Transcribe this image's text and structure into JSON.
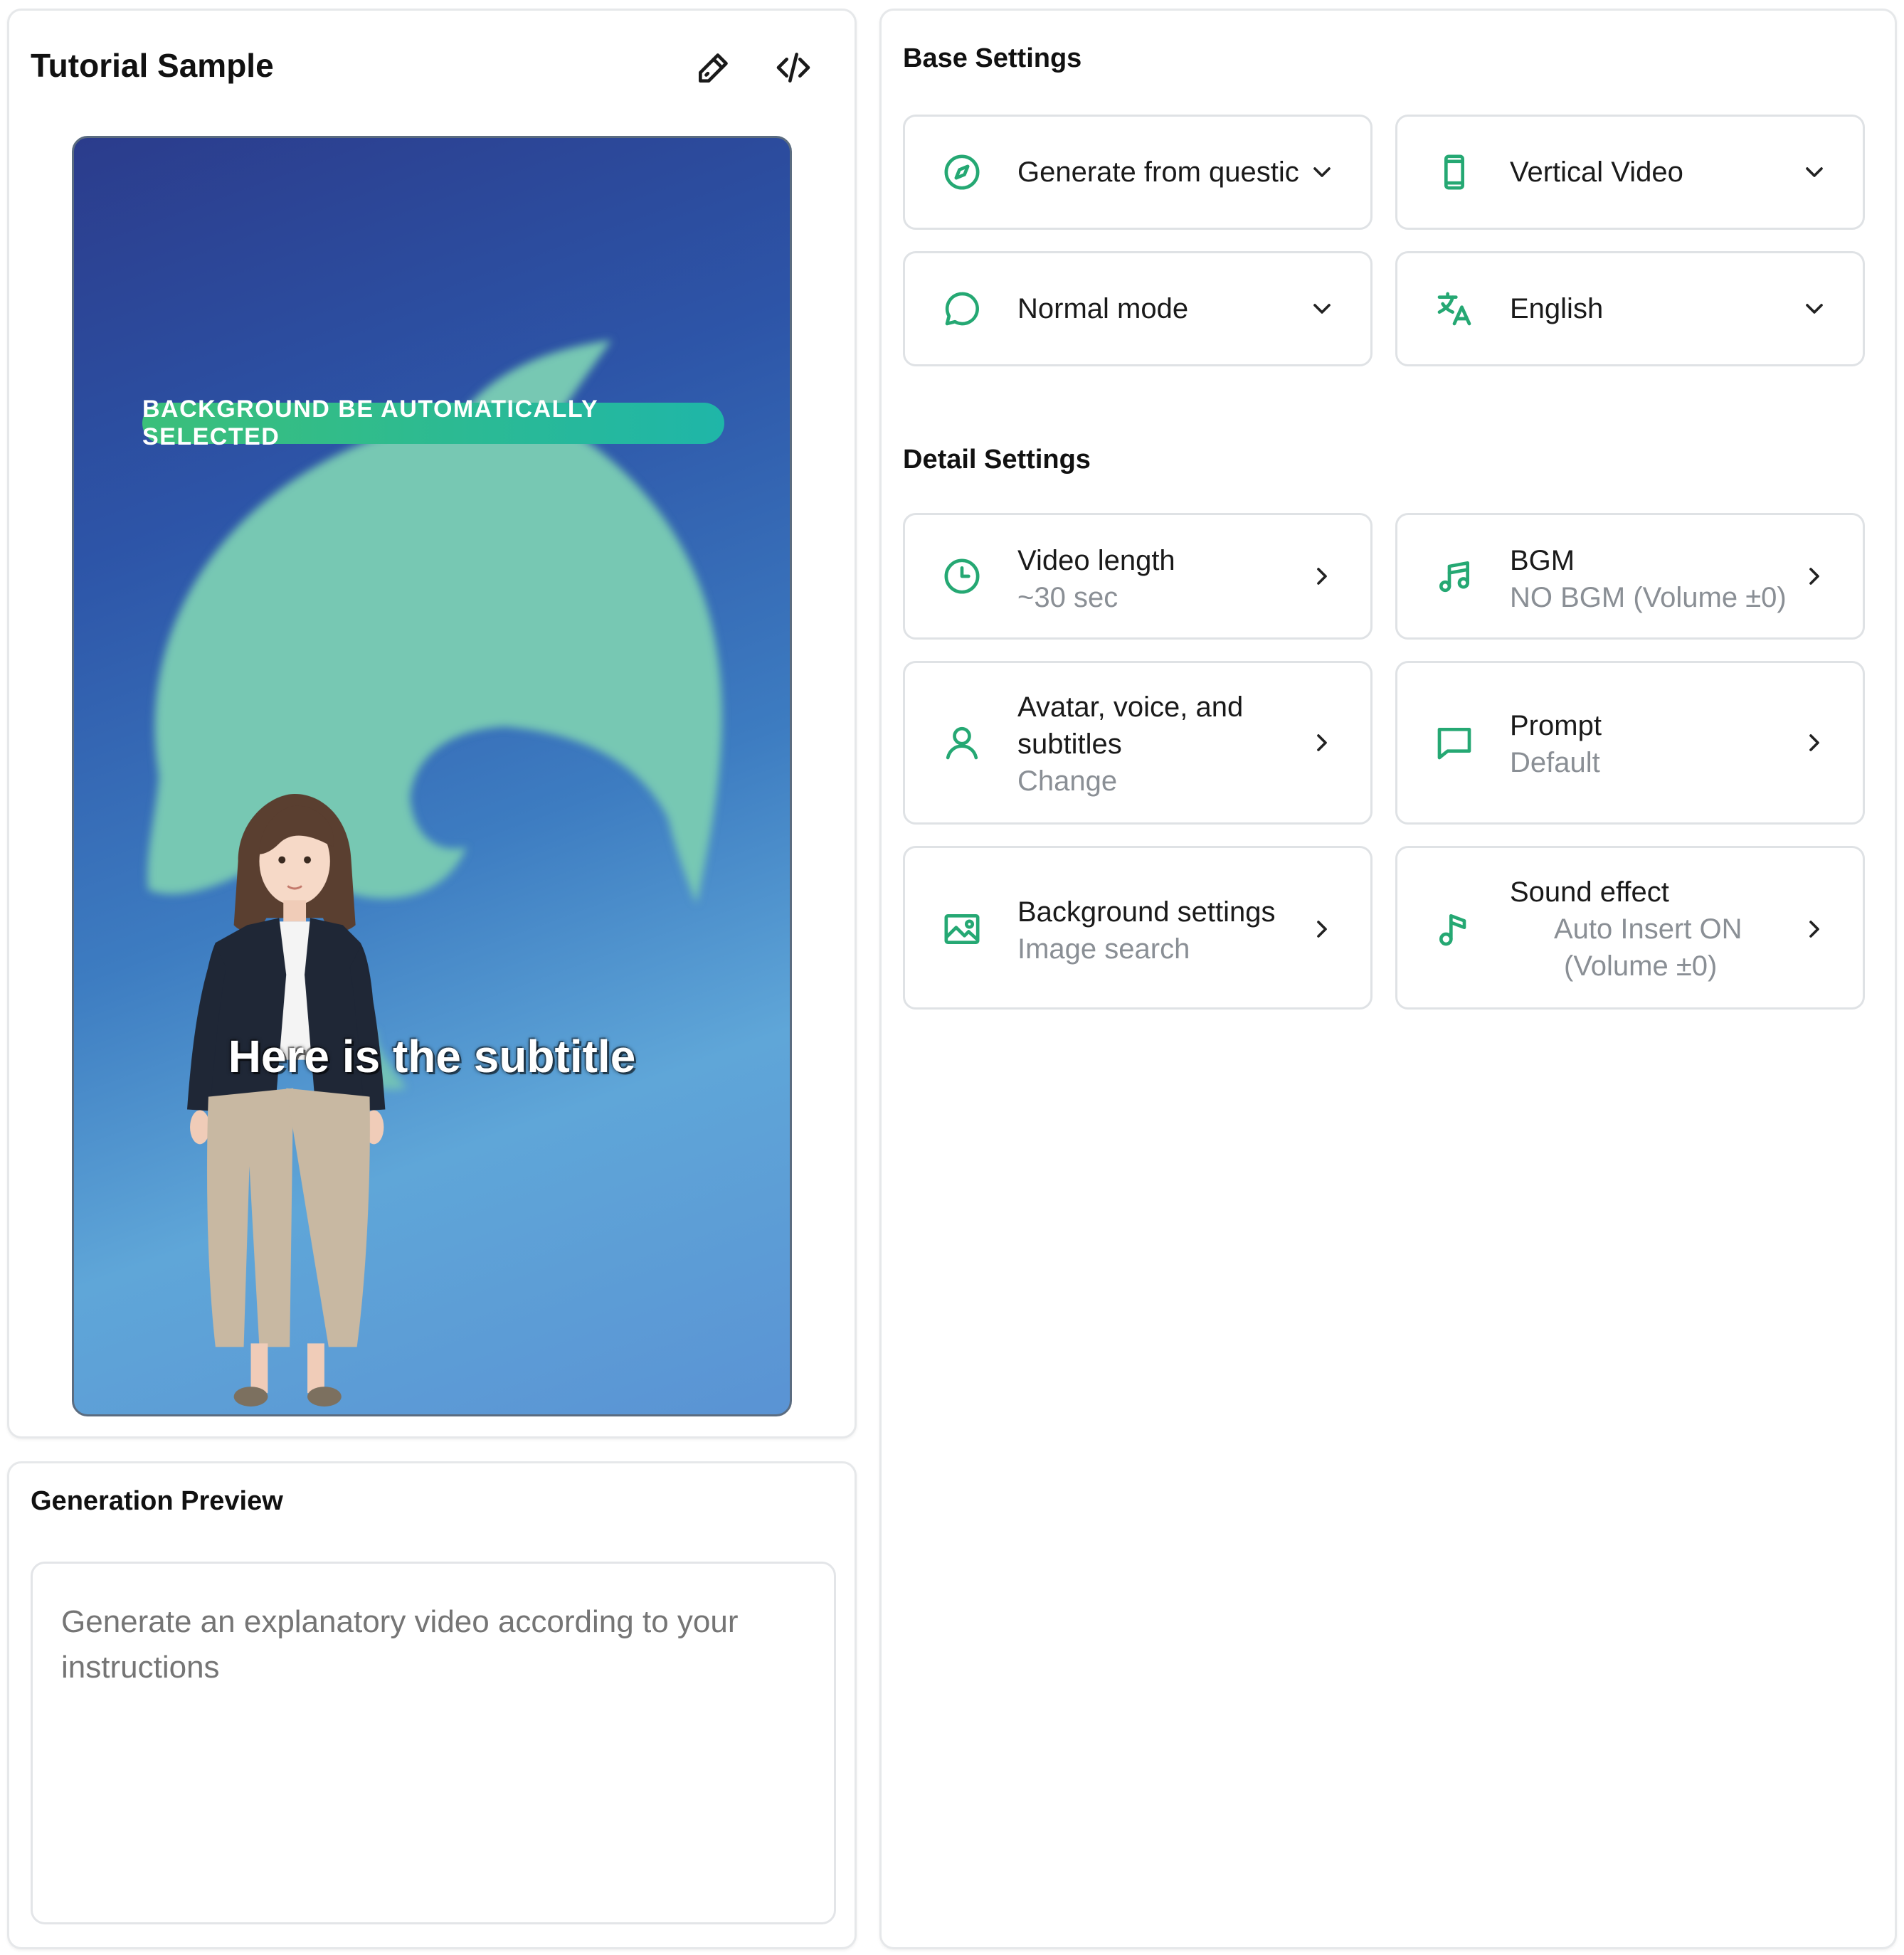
{
  "sample": {
    "title": "Tutorial Sample",
    "badge": "BACKGROUND BE AUTOMATICALLY SELECTED",
    "subtitle": "Here is the subtitle"
  },
  "generation": {
    "title": "Generation Preview",
    "placeholder": "Generate an explanatory video according to your instructions"
  },
  "base": {
    "title": "Base Settings",
    "source": "Generate from questic",
    "orientation": "Vertical Video",
    "mode": "Normal mode",
    "language": "English"
  },
  "detail": {
    "title": "Detail Settings",
    "video_length": {
      "label": "Video length",
      "value": "~30 sec"
    },
    "bgm": {
      "label": "BGM",
      "value": "NO BGM (Volume ±0)"
    },
    "avatar": {
      "label_line1": "Avatar, voice, and",
      "label_line2": "subtitles",
      "value": "Change"
    },
    "prompt": {
      "label": "Prompt",
      "value": "Default"
    },
    "background": {
      "label": "Background settings",
      "value": "Image search"
    },
    "sound_effect": {
      "label": "Sound effect",
      "value_line1": "Auto Insert ON",
      "value_line2": "(Volume ±0)"
    }
  },
  "colors": {
    "accent": "#25a873",
    "border": "#dfe2e5",
    "muted": "#8a8f95"
  },
  "icons": [
    "edit-icon",
    "code-icon",
    "compass-icon",
    "phone-icon",
    "chat-bubble-icon",
    "translate-icon",
    "clock-icon",
    "music-notes-icon",
    "user-icon",
    "message-square-icon",
    "image-icon",
    "music-note-icon",
    "chevron-down-icon",
    "chevron-right-icon"
  ]
}
